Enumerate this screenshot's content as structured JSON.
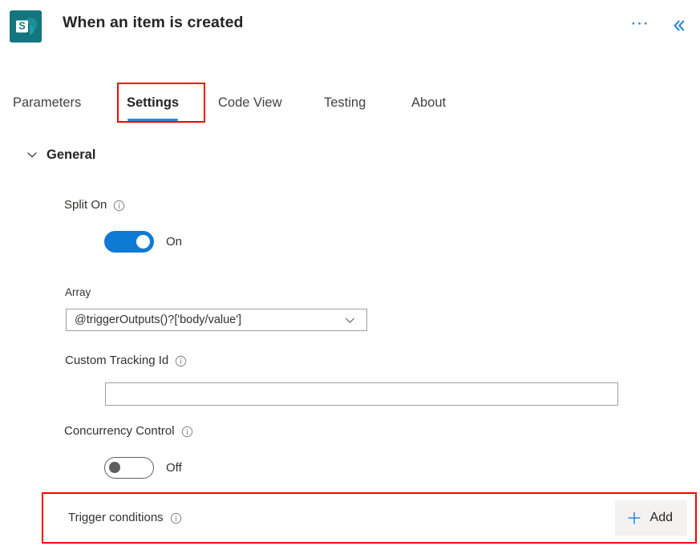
{
  "header": {
    "title": "When an item is created",
    "icon": "sharepoint-icon",
    "icon_color": "#13757e",
    "more_label": "···",
    "more_icon": "more-options-icon",
    "collapse_icon": "double-chevron-left-icon"
  },
  "tabs": [
    {
      "id": "parameters",
      "label": "Parameters",
      "active": false
    },
    {
      "id": "settings",
      "label": "Settings",
      "active": true
    },
    {
      "id": "codeview",
      "label": "Code View",
      "active": false
    },
    {
      "id": "testing",
      "label": "Testing",
      "active": false
    },
    {
      "id": "about",
      "label": "About",
      "active": false
    }
  ],
  "section": {
    "title": "General",
    "expanded": true,
    "chevron_icon": "chevron-down-icon"
  },
  "fields": {
    "split_on": {
      "label": "Split On",
      "info_icon": "info-icon",
      "toggle_state": "on",
      "toggle_text": "On"
    },
    "array": {
      "label": "Array",
      "value": "@triggerOutputs()?['body/value']",
      "chevron_icon": "chevron-down-icon"
    },
    "custom_tracking_id": {
      "label": "Custom Tracking Id",
      "info_icon": "info-icon",
      "value": "",
      "placeholder": ""
    },
    "concurrency_control": {
      "label": "Concurrency Control",
      "info_icon": "info-icon",
      "toggle_state": "off",
      "toggle_text": "Off"
    },
    "trigger_conditions": {
      "label": "Trigger conditions",
      "info_icon": "info-icon",
      "add_label": "Add",
      "add_icon": "plus-icon"
    }
  },
  "colors": {
    "accent_blue": "#0f7ad4",
    "tab_underline": "#2b88d8",
    "annotation_red": "#ff0000",
    "sharepoint_teal": "#13757e",
    "add_button_bg": "#f3f2f1"
  }
}
